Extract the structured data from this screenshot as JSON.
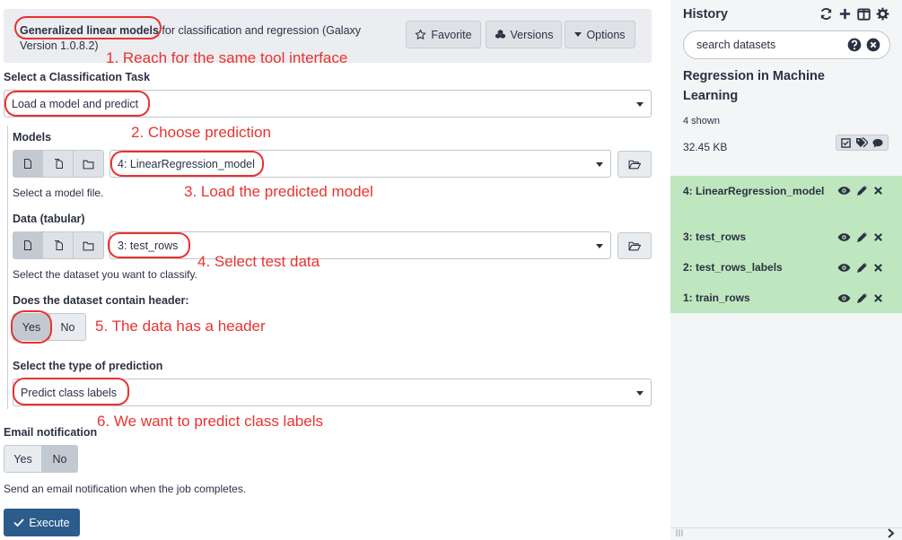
{
  "tool": {
    "name": "Generalized linear models",
    "description": " for classification and regression (Galaxy Version 1.0.8.2)",
    "favorite_label": "Favorite",
    "versions_label": "Versions",
    "options_label": "Options"
  },
  "form": {
    "task_label": "Select a Classification Task",
    "task_value": "Load a model and predict",
    "models_label": "Models",
    "models_value": "4: LinearRegression_model",
    "models_help": "Select a model file.",
    "data_label": "Data (tabular)",
    "data_value": "3: test_rows",
    "data_help": "Select the dataset you want to classify.",
    "header_label": "Does the dataset contain header:",
    "header_yes": "Yes",
    "header_no": "No",
    "header_selected": "Yes",
    "prediction_label": "Select the type of prediction",
    "prediction_value": "Predict class labels",
    "email_label": "Email notification",
    "email_yes": "Yes",
    "email_no": "No",
    "email_selected": "No",
    "email_help": "Send an email notification when the job completes.",
    "execute_label": "Execute"
  },
  "annotations": [
    "1. Reach for the same tool interface",
    "2. Choose prediction",
    "3. Load the predicted model",
    "4. Select test data",
    "5. The data has a header",
    "6. We want to predict class labels"
  ],
  "history": {
    "title": "History",
    "search_placeholder": "search datasets",
    "name": "Regression in Machine Learning",
    "shown": "4 shown",
    "size": "32.45 KB",
    "datasets": [
      {
        "label": "4: LinearRegression_model"
      },
      {
        "label": "3: test_rows"
      },
      {
        "label": "2: test_rows_labels"
      },
      {
        "label": "1: train_rows"
      }
    ]
  },
  "colors": {
    "accent_red": "#e8332f",
    "execute_blue": "#2b5c8b",
    "dataset_green": "#bfe7bf"
  }
}
